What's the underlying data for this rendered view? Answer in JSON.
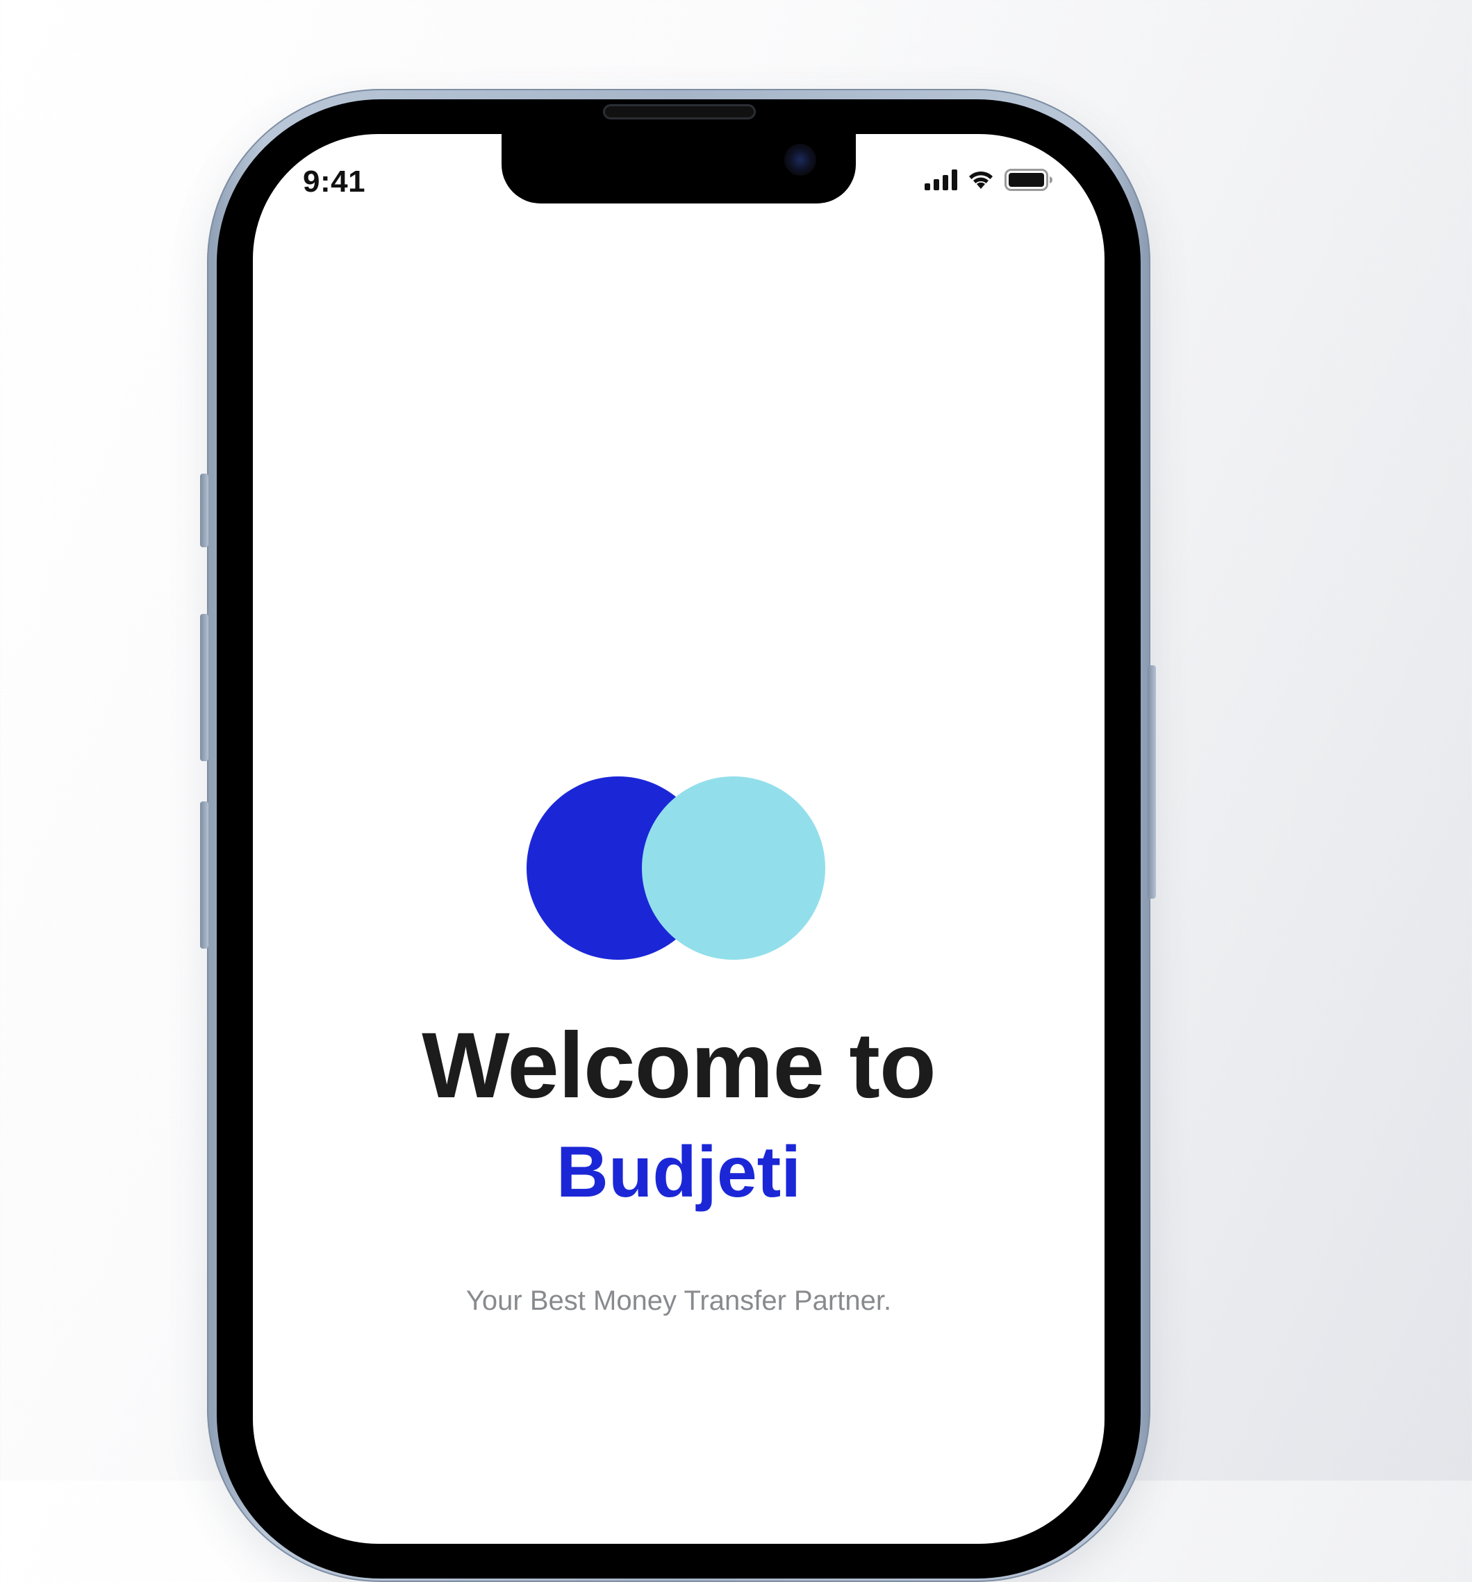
{
  "status_bar": {
    "time": "9:41",
    "icons": [
      "signal-icon",
      "wifi-icon",
      "battery-icon"
    ]
  },
  "welcome": {
    "title": "Welcome to",
    "brand": "Budjeti",
    "tagline": "Your Best Money Transfer Partner."
  },
  "logo": {
    "icon": "two-overlapping-circles-logo",
    "colors": {
      "dark_circle": "#1b27d6",
      "light_circle": "#92dfeb"
    }
  },
  "colors": {
    "accent": "#1b27d6",
    "title_text": "#1c1c1c",
    "tagline_text": "#888a8e",
    "screen_background": "#ffffff"
  }
}
